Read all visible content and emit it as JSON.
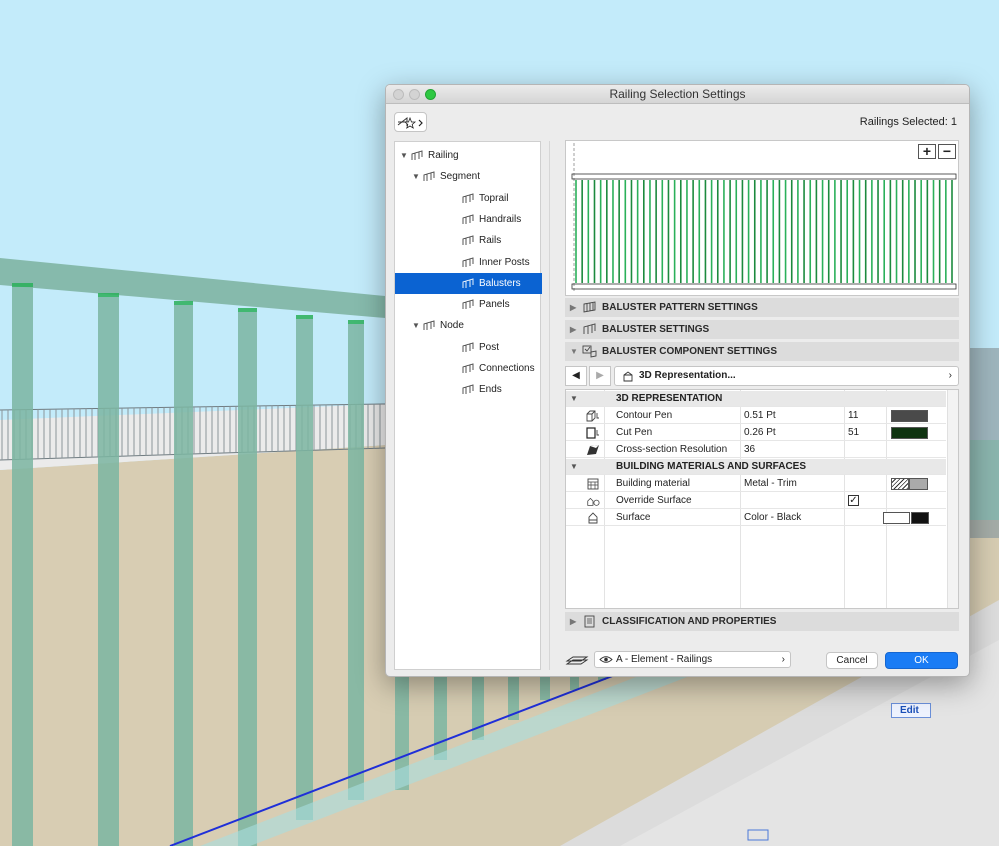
{
  "dialog": {
    "title": "Railing Selection Settings",
    "selection_count": "Railings Selected: 1"
  },
  "tree": {
    "items": [
      {
        "label": "Railing",
        "level": 0,
        "expanded": true,
        "selected": false,
        "icon": "railing-icon"
      },
      {
        "label": "Segment",
        "level": 1,
        "expanded": true,
        "selected": false,
        "icon": "segment-icon"
      },
      {
        "label": "Toprail",
        "level": 2,
        "selected": false,
        "icon": "toprail-icon"
      },
      {
        "label": "Handrails",
        "level": 2,
        "selected": false,
        "icon": "handrails-icon"
      },
      {
        "label": "Rails",
        "level": 2,
        "selected": false,
        "icon": "rails-icon"
      },
      {
        "label": "Inner Posts",
        "level": 2,
        "selected": false,
        "icon": "inner-posts-icon"
      },
      {
        "label": "Balusters",
        "level": 2,
        "selected": true,
        "icon": "balusters-icon"
      },
      {
        "label": "Panels",
        "level": 2,
        "selected": false,
        "icon": "panels-icon"
      },
      {
        "label": "Node",
        "level": 1,
        "expanded": true,
        "selected": false,
        "icon": "node-icon"
      },
      {
        "label": "Post",
        "level": 2,
        "selected": false,
        "icon": "post-icon"
      },
      {
        "label": "Connections",
        "level": 2,
        "selected": false,
        "icon": "connections-icon"
      },
      {
        "label": "Ends",
        "level": 2,
        "selected": false,
        "icon": "ends-icon"
      }
    ]
  },
  "sections": {
    "pattern": "BALUSTER PATTERN SETTINGS",
    "baluster": "BALUSTER SETTINGS",
    "component": "BALUSTER COMPONENT SETTINGS",
    "classification": "CLASSIFICATION AND PROPERTIES"
  },
  "nav": {
    "page": "3D Representation..."
  },
  "properties": {
    "group_3d": "3D REPRESENTATION",
    "contour_pen": {
      "name": "Contour Pen",
      "value": "0.51 Pt",
      "pen": "11",
      "color": "#4a4a4a"
    },
    "cut_pen": {
      "name": "Cut Pen",
      "value": "0.26 Pt",
      "pen": "51",
      "color": "#0f3310"
    },
    "resolution": {
      "name": "Cross-section Resolution",
      "value": "36"
    },
    "group_materials": "BUILDING MATERIALS AND SURFACES",
    "building_material": {
      "name": "Building material",
      "value": "Metal - Trim"
    },
    "override_surface": {
      "name": "Override Surface",
      "checked": true
    },
    "surface": {
      "name": "Surface",
      "value": "Color - Black"
    }
  },
  "footer": {
    "layer": "A - Element - Railings",
    "cancel": "Cancel",
    "ok": "OK"
  },
  "canvas": {
    "edit_tag": "Edit"
  },
  "colors": {
    "accent": "#0b63d2",
    "ok_button": "#1a7cf5",
    "baluster_green": "#2bb05a"
  }
}
